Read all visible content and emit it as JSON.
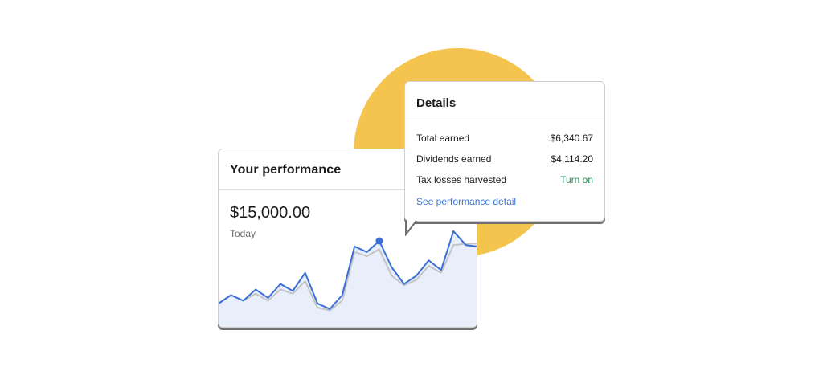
{
  "performance": {
    "title": "Your performance",
    "amount": "$15,000.00",
    "period": "Today",
    "chart_data": {
      "type": "line",
      "x": [
        0,
        1,
        2,
        3,
        4,
        5,
        6,
        7,
        8,
        9,
        10,
        11,
        12,
        13,
        14,
        15,
        16,
        17,
        18,
        19,
        20,
        21
      ],
      "series": [
        {
          "values": [
            0.18,
            0.24,
            0.2,
            0.28,
            0.22,
            0.32,
            0.27,
            0.4,
            0.18,
            0.14,
            0.24,
            0.59,
            0.55,
            0.63,
            0.44,
            0.32,
            0.38,
            0.49,
            0.42,
            0.7,
            0.6,
            0.59
          ]
        },
        {
          "values": [
            0.18,
            0.24,
            0.2,
            0.25,
            0.2,
            0.28,
            0.25,
            0.34,
            0.15,
            0.13,
            0.2,
            0.55,
            0.52,
            0.57,
            0.38,
            0.31,
            0.35,
            0.45,
            0.4,
            0.6,
            0.61,
            0.61
          ]
        }
      ],
      "colors": {
        "primary": "#3a6fd8",
        "secondary": "#c4c4c4",
        "fill": "#e9eefb"
      },
      "highlight_index": 13
    }
  },
  "details": {
    "title": "Details",
    "rows": [
      {
        "label": "Total earned",
        "value": "$6,340.67"
      },
      {
        "label": "Dividends earned",
        "value": "$4,114.20"
      },
      {
        "label": "Tax losses harvested",
        "value": "Turn on"
      }
    ],
    "link": "See performance detail"
  },
  "colors": {
    "accent_circle": "#f5c44e",
    "link": "#3a73d6",
    "positive": "#1f8a54"
  }
}
